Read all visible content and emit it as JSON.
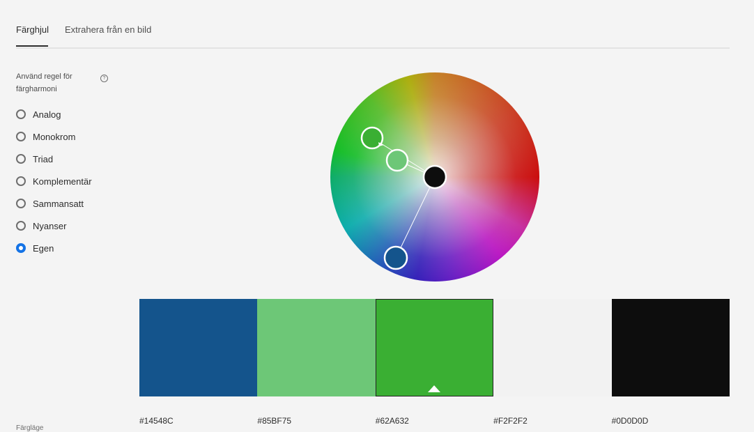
{
  "tabs": [
    {
      "label": "Färghjul",
      "active": true
    },
    {
      "label": "Extrahera från en bild",
      "active": false
    }
  ],
  "harmony": {
    "label": "Använd regel för färgharmoni",
    "help_icon": "question-circle-icon",
    "options": [
      {
        "label": "Analog",
        "checked": false
      },
      {
        "label": "Monokrom",
        "checked": false
      },
      {
        "label": "Triad",
        "checked": false
      },
      {
        "label": "Komplementär",
        "checked": false
      },
      {
        "label": "Sammansatt",
        "checked": false
      },
      {
        "label": "Nyanser",
        "checked": false
      },
      {
        "label": "Egen",
        "checked": true
      }
    ]
  },
  "swatches": [
    {
      "hex": "#14548C",
      "color": "#14548C",
      "selected": false
    },
    {
      "hex": "#85BF75",
      "color": "#6DC777",
      "selected": false
    },
    {
      "hex": "#62A632",
      "color": "#3AAF33",
      "selected": true
    },
    {
      "hex": "#F2F2F2",
      "color": "#F2F2F2",
      "selected": false
    },
    {
      "hex": "#0D0D0D",
      "color": "#0D0D0D",
      "selected": false
    }
  ],
  "bottom_label": "Färgläge",
  "colors": {
    "accent": "#1473e6",
    "background": "#f4f4f4"
  }
}
